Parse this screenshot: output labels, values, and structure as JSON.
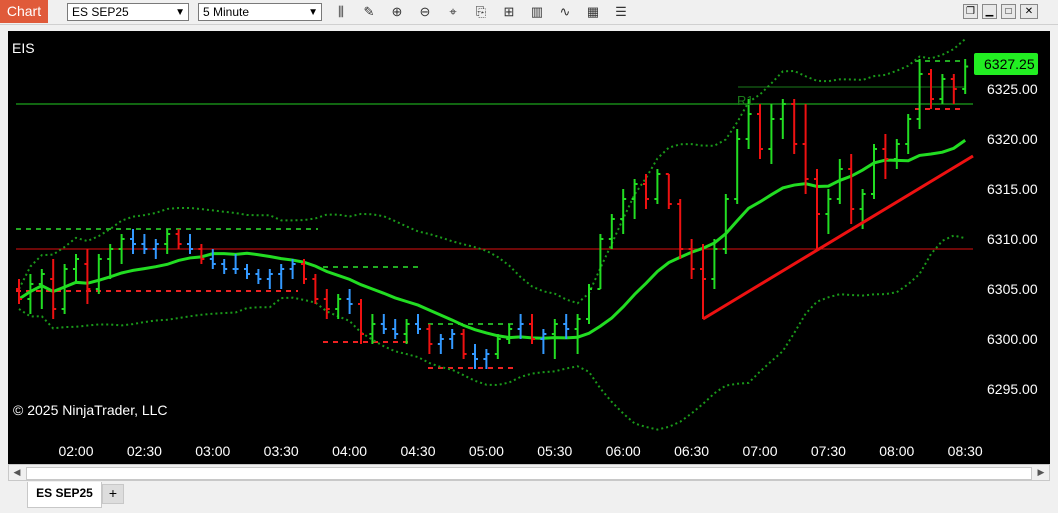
{
  "toolbar": {
    "title": "Chart",
    "instrument": "ES SEP25",
    "interval": "5 Minute",
    "icons": [
      "data-series-icon",
      "drawing-tool-icon",
      "zoom-in-icon",
      "zoom-out-icon",
      "crosshair-icon",
      "strategies-icon",
      "indicators-icon",
      "chart-style-icon",
      "line-icon",
      "templates-icon",
      "properties-icon"
    ]
  },
  "window_controls": [
    "restore-icon",
    "minimize-icon",
    "maximize-icon",
    "close-icon"
  ],
  "chart": {
    "instrument_label": "EIS",
    "copyright": "© 2025 NinjaTrader, LLC",
    "pivot_label": "R1",
    "last_price": "6327.25",
    "last_price_color": "#22ee22",
    "ticks_y": [
      "6325.00",
      "6320.00",
      "6315.00",
      "6310.00",
      "6305.00",
      "6300.00",
      "6295.00"
    ],
    "ticks_x": [
      "02:00",
      "02:30",
      "03:00",
      "03:30",
      "04:00",
      "04:30",
      "05:00",
      "05:30",
      "06:00",
      "06:30",
      "07:00",
      "07:30",
      "08:00",
      "08:30"
    ],
    "colors": {
      "up": "#22dd22",
      "down": "#ee1111",
      "neutral": "#3399ff",
      "band": "#1a9a1a"
    }
  },
  "chart_data": {
    "type": "ohlc",
    "ylim": [
      6292,
      6330
    ],
    "bars": [
      [
        "01:35",
        6305.0,
        6306.0,
        6303.5,
        6304.0
      ],
      [
        "01:40",
        6304.0,
        6306.5,
        6302.5,
        6305.5
      ],
      [
        "01:45",
        6305.5,
        6307.0,
        6303.0,
        6306.5
      ],
      [
        "01:50",
        6306.0,
        6308.0,
        6302.0,
        6303.0
      ],
      [
        "01:55",
        6303.0,
        6307.5,
        6302.5,
        6307.0
      ],
      [
        "02:00",
        6307.0,
        6308.5,
        6305.5,
        6308.0
      ],
      [
        "02:05",
        6307.5,
        6309.0,
        6303.5,
        6305.0
      ],
      [
        "02:10",
        6305.0,
        6308.5,
        6304.5,
        6308.0
      ],
      [
        "02:15",
        6308.0,
        6309.5,
        6306.0,
        6309.0
      ],
      [
        "02:20",
        6309.0,
        6310.5,
        6307.5,
        6310.0
      ],
      [
        "02:25",
        6310.0,
        6311.0,
        6308.5,
        6309.5
      ],
      [
        "02:30",
        6309.5,
        6310.5,
        6308.5,
        6309.0
      ],
      [
        "02:35",
        6309.0,
        6310.0,
        6308.0,
        6309.5
      ],
      [
        "02:40",
        6309.5,
        6311.0,
        6308.5,
        6310.5
      ],
      [
        "02:45",
        6310.5,
        6311.0,
        6309.0,
        6309.5
      ],
      [
        "02:50",
        6309.5,
        6310.5,
        6308.5,
        6309.0
      ],
      [
        "02:55",
        6309.0,
        6309.5,
        6307.5,
        6308.0
      ],
      [
        "03:00",
        6308.0,
        6309.0,
        6307.0,
        6307.5
      ],
      [
        "03:05",
        6307.5,
        6308.0,
        6306.5,
        6307.0
      ],
      [
        "03:10",
        6307.0,
        6308.5,
        6306.5,
        6307.0
      ],
      [
        "03:15",
        6307.0,
        6307.5,
        6306.0,
        6306.5
      ],
      [
        "03:20",
        6306.5,
        6307.0,
        6305.5,
        6306.0
      ],
      [
        "03:25",
        6306.0,
        6307.0,
        6305.0,
        6306.5
      ],
      [
        "03:30",
        6306.5,
        6307.5,
        6305.0,
        6307.0
      ],
      [
        "03:35",
        6307.0,
        6308.0,
        6306.0,
        6307.5
      ],
      [
        "03:40",
        6307.5,
        6308.0,
        6305.5,
        6306.0
      ],
      [
        "03:45",
        6306.0,
        6306.5,
        6303.5,
        6304.0
      ],
      [
        "03:50",
        6304.0,
        6305.0,
        6302.0,
        6303.0
      ],
      [
        "03:55",
        6303.0,
        6304.5,
        6302.0,
        6304.0
      ],
      [
        "04:00",
        6304.0,
        6305.0,
        6302.5,
        6303.5
      ],
      [
        "04:05",
        6303.5,
        6304.0,
        6299.5,
        6300.5
      ],
      [
        "04:10",
        6300.5,
        6302.5,
        6299.5,
        6301.5
      ],
      [
        "04:15",
        6301.5,
        6302.5,
        6300.5,
        6301.0
      ],
      [
        "04:20",
        6301.0,
        6302.0,
        6300.0,
        6300.5
      ],
      [
        "04:25",
        6300.5,
        6302.0,
        6299.5,
        6301.5
      ],
      [
        "04:30",
        6301.5,
        6302.5,
        6300.5,
        6301.0
      ],
      [
        "04:35",
        6301.0,
        6301.5,
        6298.5,
        6299.5
      ],
      [
        "04:40",
        6299.5,
        6300.5,
        6298.5,
        6300.0
      ],
      [
        "04:45",
        6300.0,
        6301.0,
        6299.0,
        6300.5
      ],
      [
        "04:50",
        6300.5,
        6301.0,
        6298.0,
        6298.5
      ],
      [
        "04:55",
        6298.5,
        6299.5,
        6297.0,
        6298.0
      ],
      [
        "05:00",
        6298.0,
        6299.0,
        6297.0,
        6298.5
      ],
      [
        "05:05",
        6298.5,
        6300.5,
        6298.0,
        6300.0
      ],
      [
        "05:10",
        6300.0,
        6301.5,
        6299.5,
        6301.0
      ],
      [
        "05:15",
        6301.0,
        6302.5,
        6300.0,
        6301.5
      ],
      [
        "05:20",
        6301.5,
        6302.5,
        6299.5,
        6300.0
      ],
      [
        "05:25",
        6300.0,
        6301.0,
        6298.5,
        6300.5
      ],
      [
        "05:30",
        6300.5,
        6302.0,
        6298.0,
        6301.5
      ],
      [
        "05:35",
        6301.5,
        6302.5,
        6300.0,
        6301.0
      ],
      [
        "05:40",
        6301.0,
        6302.5,
        6298.5,
        6302.0
      ],
      [
        "05:45",
        6302.0,
        6305.5,
        6301.5,
        6305.0
      ],
      [
        "05:50",
        6305.0,
        6310.5,
        6305.0,
        6310.0
      ],
      [
        "05:55",
        6310.0,
        6312.5,
        6309.0,
        6312.0
      ],
      [
        "06:00",
        6312.0,
        6315.0,
        6310.5,
        6314.0
      ],
      [
        "06:05",
        6314.0,
        6316.0,
        6312.0,
        6315.5
      ],
      [
        "06:10",
        6315.5,
        6316.5,
        6313.0,
        6314.0
      ],
      [
        "06:15",
        6314.0,
        6317.0,
        6313.5,
        6316.5
      ],
      [
        "06:20",
        6316.5,
        6316.5,
        6313.0,
        6313.5
      ],
      [
        "06:25",
        6313.5,
        6314.0,
        6308.0,
        6309.0
      ],
      [
        "06:30",
        6309.0,
        6310.0,
        6306.0,
        6307.0
      ],
      [
        "06:35",
        6307.0,
        6309.5,
        6302.0,
        6306.0
      ],
      [
        "06:40",
        6306.0,
        6310.0,
        6305.0,
        6309.0
      ],
      [
        "06:45",
        6309.0,
        6314.5,
        6308.5,
        6314.0
      ],
      [
        "06:50",
        6314.0,
        6321.0,
        6313.5,
        6320.0
      ],
      [
        "06:55",
        6320.0,
        6324.0,
        6319.0,
        6322.5
      ],
      [
        "07:00",
        6322.5,
        6323.5,
        6318.0,
        6319.0
      ],
      [
        "07:05",
        6319.0,
        6323.5,
        6317.5,
        6322.0
      ],
      [
        "07:10",
        6322.0,
        6324.0,
        6320.0,
        6323.5
      ],
      [
        "07:15",
        6323.5,
        6324.0,
        6318.5,
        6319.5
      ],
      [
        "07:20",
        6319.5,
        6323.5,
        6314.5,
        6316.0
      ],
      [
        "07:25",
        6316.0,
        6317.0,
        6309.0,
        6312.5
      ],
      [
        "07:30",
        6312.5,
        6315.0,
        6310.5,
        6314.0
      ],
      [
        "07:35",
        6314.0,
        6318.0,
        6313.5,
        6317.0
      ],
      [
        "07:40",
        6317.0,
        6318.5,
        6311.5,
        6313.0
      ],
      [
        "07:45",
        6313.0,
        6315.0,
        6311.0,
        6314.5
      ],
      [
        "07:50",
        6314.5,
        6319.5,
        6314.0,
        6319.0
      ],
      [
        "07:55",
        6319.0,
        6320.5,
        6316.0,
        6318.0
      ],
      [
        "08:00",
        6318.0,
        6320.0,
        6317.0,
        6319.5
      ],
      [
        "08:05",
        6319.5,
        6322.5,
        6318.5,
        6322.0
      ],
      [
        "08:10",
        6322.0,
        6328.0,
        6321.0,
        6326.5
      ],
      [
        "08:15",
        6326.5,
        6327.0,
        6323.0,
        6324.0
      ],
      [
        "08:20",
        6324.0,
        6326.5,
        6323.5,
        6326.0
      ],
      [
        "08:25",
        6326.0,
        6326.5,
        6323.5,
        6325.0
      ],
      [
        "08:30",
        6325.0,
        6328.0,
        6324.5,
        6327.25
      ]
    ]
  }
}
